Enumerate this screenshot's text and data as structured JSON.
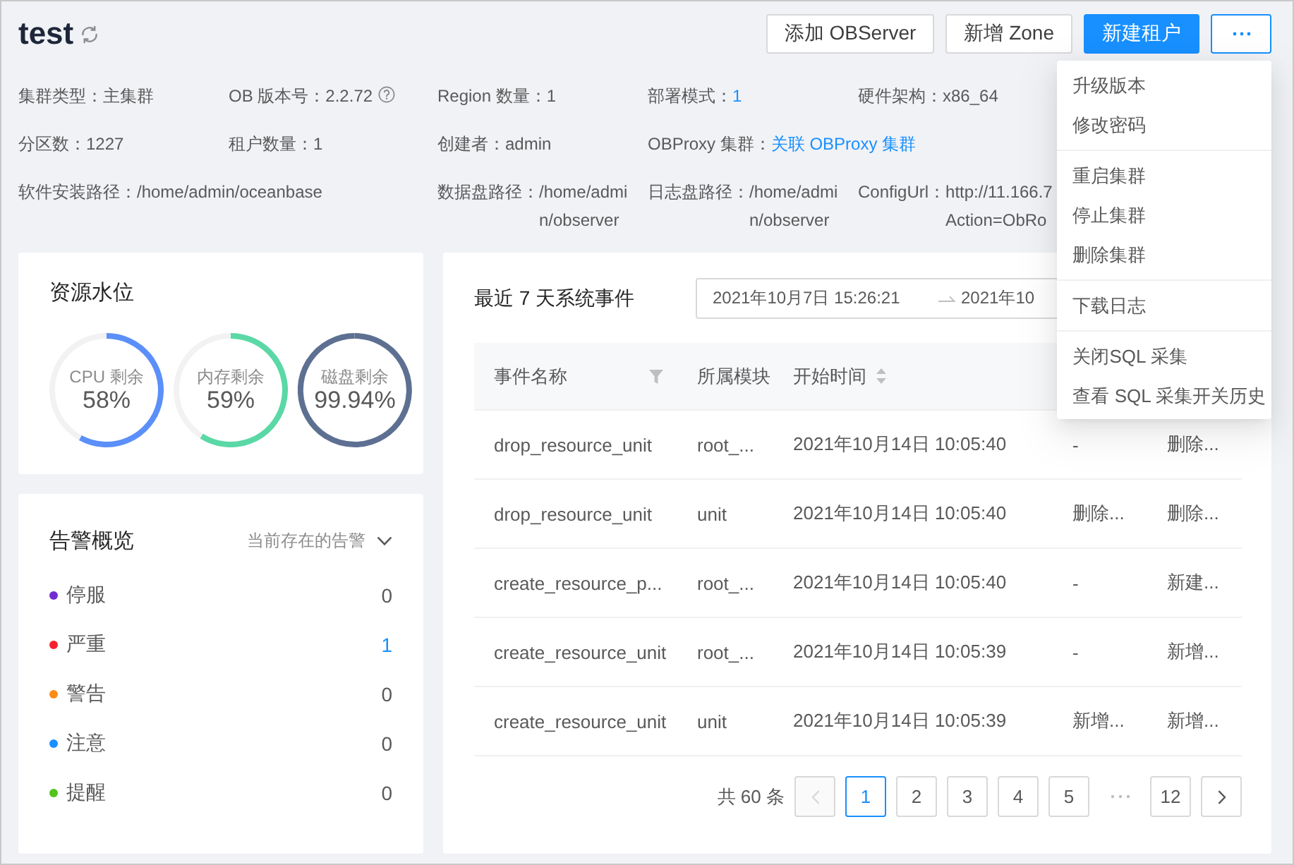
{
  "header": {
    "title": "test",
    "buttons": [
      {
        "label": "添加 OBServer",
        "kind": "default"
      },
      {
        "label": "新增 Zone",
        "kind": "default"
      },
      {
        "label": "新建租户",
        "kind": "primary"
      }
    ],
    "more": {
      "expanded": true,
      "groups": [
        {
          "items": [
            "升级版本",
            "修改密码"
          ]
        },
        {
          "items": [
            "重启集群",
            "停止集群",
            "删除集群"
          ]
        },
        {
          "items": [
            "下载日志"
          ]
        },
        {
          "items": [
            "关闭SQL 采集",
            "查看 SQL 采集开关历史"
          ]
        }
      ]
    }
  },
  "info_rows": [
    [
      {
        "label": "集群类型：",
        "value": "主集群",
        "kind": "text"
      },
      {
        "label": "OB 版本号：",
        "value": "2.2.72",
        "kind": "help"
      },
      {
        "label": "Region 数量：",
        "value": "1",
        "kind": "text"
      },
      {
        "label": "部署模式：",
        "value": "1",
        "kind": "link"
      },
      {
        "label": "硬件架构：",
        "value": "x86_64",
        "kind": "text"
      }
    ],
    [
      {
        "label": "分区数：",
        "value": "1227",
        "kind": "text"
      },
      {
        "label": "租户数量：",
        "value": "1",
        "kind": "text"
      },
      {
        "label": "创建者：",
        "value": "admin",
        "kind": "text"
      },
      {
        "label": "OBProxy 集群：",
        "value": "关联 OBProxy 集群",
        "kind": "link"
      }
    ],
    [
      {
        "label": "软件安装路径：",
        "value": "/home/admin/oceanbase",
        "kind": "wide"
      },
      {
        "label": "数据盘路径：",
        "value": "/home/admin/observer",
        "kind": "path"
      },
      {
        "label": "日志盘路径：",
        "value": "/home/admin/observer",
        "kind": "path"
      },
      {
        "label": "ConfigUrl：",
        "value_lines": [
          "http://11.166.7",
          "Action=ObRo"
        ],
        "kind": "lines"
      }
    ]
  ],
  "resources": {
    "title": "资源水位",
    "gauges": [
      {
        "label": "CPU 剩余",
        "reading": "58%",
        "color": "#5b8ff9"
      },
      {
        "label": "内存剩余",
        "reading": "59%",
        "color": "#5ad8a6"
      },
      {
        "label": "磁盘剩余",
        "reading": "99.94%",
        "color": "#5d7092"
      }
    ]
  },
  "alerts": {
    "title": "告警概览",
    "filter": "当前存在的告警",
    "items": [
      {
        "label": "停服",
        "count": "0",
        "color": "#722ed1",
        "linked": false
      },
      {
        "label": "严重",
        "count": "1",
        "color": "#f5222d",
        "linked": true
      },
      {
        "label": "警告",
        "count": "0",
        "color": "#fa8c16",
        "linked": false
      },
      {
        "label": "注意",
        "count": "0",
        "color": "#1890ff",
        "linked": false
      },
      {
        "label": "提醒",
        "count": "0",
        "color": "#52c41a",
        "linked": false
      }
    ]
  },
  "events": {
    "title": "最近 7 天系统事件",
    "range": {
      "start": "2021年10月7日 15:26:21",
      "end": "2021年10"
    },
    "columns": [
      {
        "label": "事件名称",
        "kind": "filter"
      },
      {
        "label": "所属模块",
        "kind": "plain"
      },
      {
        "label": "开始时间",
        "kind": "sort"
      }
    ],
    "rows": [
      [
        "drop_resource_unit",
        "root_...",
        "2021年10月14日 10:05:40",
        "-",
        "删除..."
      ],
      [
        "drop_resource_unit",
        "unit",
        "2021年10月14日 10:05:40",
        "删除...",
        "删除..."
      ],
      [
        "create_resource_p...",
        "root_...",
        "2021年10月14日 10:05:40",
        "-",
        "新建..."
      ],
      [
        "create_resource_unit",
        "root_...",
        "2021年10月14日 10:05:39",
        "-",
        "新增..."
      ],
      [
        "create_resource_unit",
        "unit",
        "2021年10月14日 10:05:39",
        "新增...",
        "新增..."
      ]
    ],
    "pagination": {
      "total": "共 60 条",
      "prev_disabled": true,
      "pages": [
        {
          "label": "1",
          "selected": true
        },
        {
          "label": "2",
          "selected": false
        },
        {
          "label": "3",
          "selected": false
        },
        {
          "label": "4",
          "selected": false
        },
        {
          "label": "5",
          "selected": false
        }
      ],
      "ellipsis": true,
      "last": {
        "label": "12",
        "selected": false
      },
      "next_disabled": false
    }
  }
}
